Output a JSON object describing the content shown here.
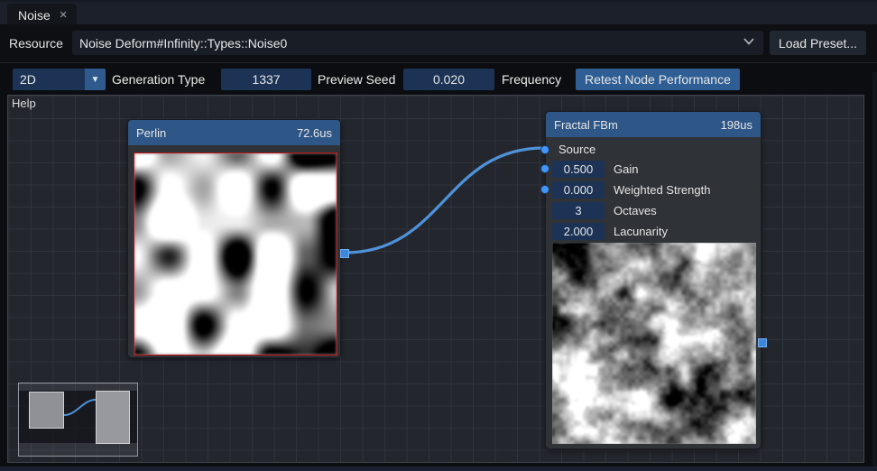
{
  "tab": {
    "title": "Noise",
    "close_icon": "×"
  },
  "resource_bar": {
    "label": "Resource",
    "value": "Noise Deform#Infinity::Types::Noise0",
    "load_preset_label": "Load Preset..."
  },
  "toolbar": {
    "dimension_value": "2D",
    "dropdown_icon": "▼",
    "generation_type_label": "Generation Type",
    "preview_seed_value": "1337",
    "preview_seed_label": "Preview Seed",
    "frequency_value": "0.020",
    "frequency_label": "Frequency",
    "retest_button_label": "Retest Node Performance"
  },
  "graph": {
    "help_label": "Help"
  },
  "nodes": {
    "perlin": {
      "title": "Perlin",
      "time": "72.6us"
    },
    "fractal_fbm": {
      "title": "Fractal FBm",
      "time": "198us",
      "source_label": "Source",
      "fields": [
        {
          "value": "0.500",
          "label": "Gain"
        },
        {
          "value": "0.000",
          "label": "Weighted Strength"
        },
        {
          "value": "3",
          "label": "Octaves"
        },
        {
          "value": "2.000",
          "label": "Lacunarity"
        }
      ]
    }
  },
  "colors": {
    "node_header": "#2e5687",
    "accent_pin": "#4296fa",
    "link": "#4f92d9",
    "frame_bg": "#1d3356",
    "button_bg": "#2f5e94",
    "selected_preview_border": "#c41414"
  }
}
